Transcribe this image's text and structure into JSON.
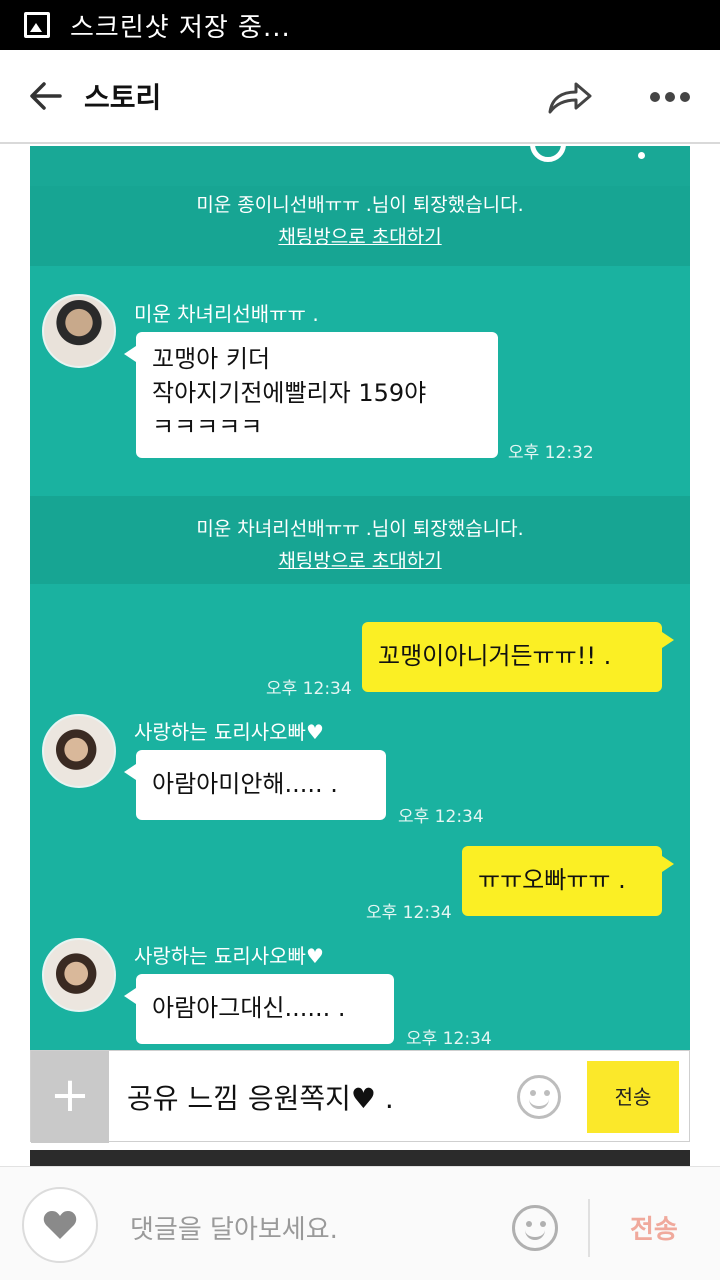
{
  "statusbar": {
    "notification": "스크린샷 저장 중..."
  },
  "appbar": {
    "title": "스토리"
  },
  "chat": {
    "notices": [
      {
        "text": "미운 종이니선배ㅠㅠ .님이 퇴장했습니다.",
        "link": "채팅방으로 초대하기"
      },
      {
        "text": "미운 차녀리선배ㅠㅠ .님이 퇴장했습니다.",
        "link": "채팅방으로 초대하기"
      }
    ],
    "messages": [
      {
        "sender": "미운 차녀리선배ㅠㅠ .",
        "lines": [
          "꼬맹아 키더",
          "작아지기전에빨리자 159야",
          "ㅋㅋㅋㅋㅋ"
        ],
        "time": "오후 12:32"
      },
      {
        "lines": [
          "꼬맹이아니거든ㅠㅠ!! ."
        ],
        "time": "오후 12:34"
      },
      {
        "sender": "사랑하는 됴리사오빠♥",
        "lines": [
          "아람아미안해..... ."
        ],
        "time": "오후 12:34"
      },
      {
        "lines": [
          "ㅠㅠ오빠ㅠㅠ ."
        ],
        "time": "오후 12:34"
      },
      {
        "sender": "사랑하는 됴리사오빠♥",
        "lines": [
          "아람아그대신...... ."
        ],
        "time": "오후 12:34"
      }
    ]
  },
  "inputbar": {
    "plus": "+",
    "text": "공유 느낌 응원쪽지♥ .",
    "send_label": "전송"
  },
  "comment": {
    "placeholder": "댓글을 달아보세요.",
    "send_label": "전송"
  }
}
